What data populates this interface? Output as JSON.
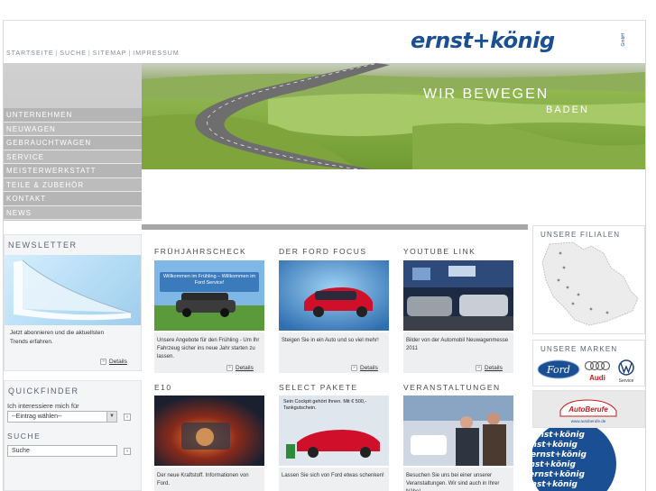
{
  "header": {
    "top_links": [
      "STARTSEITE",
      "SUCHE",
      "SITEMAP",
      "IMPRESSUM"
    ],
    "logo_text": "ernst+könig",
    "logo_suffix": "GmbH"
  },
  "nav": {
    "items": [
      "UNTERNEHMEN",
      "NEUWAGEN",
      "GEBRAUCHTWAGEN",
      "SERVICE",
      "MEISTERWERKSTATT",
      "TEILE & ZUBEHÖR",
      "KONTAKT",
      "NEWS"
    ]
  },
  "hero": {
    "title": "WIR BEWEGEN",
    "subtitle": "BADEN"
  },
  "newsletter": {
    "title": "NEWSLETTER",
    "text": "Jetzt abonnieren und die aktuellsten Trends erfahren.",
    "details_label": "Details"
  },
  "quickfinder": {
    "title": "QUICKFINDER",
    "interest_label": "Ich interessiere mich für",
    "select_value": "--Eintrag wählen--",
    "search_title": "SUCHE",
    "search_value": "Suche"
  },
  "tiles": [
    {
      "title": "FRÜHJAHRSCHECK",
      "image_caption": "Willkommen im Frühling – Willkommen im Ford Service!",
      "text": "Unsere Angebote für den Frühling - Um Ihr Fahrzeug sicher ins neue Jahr starten zu lassen.",
      "details_label": "Details"
    },
    {
      "title": "DER FORD FOCUS",
      "text": "Steigen Sie in ein Auto und so viel mehr!",
      "details_label": "Details"
    },
    {
      "title": "YOUTUBE LINK",
      "text": "Bilder von der Automobil Neuwagenmesse 2011",
      "details_label": "Details"
    },
    {
      "title": "E10",
      "text": "Der neue Kraftstoff. Informationen von Ford."
    },
    {
      "title": "SELECT PAKETE",
      "image_caption": "Sein Cockpit gehört Ihnen. Mit € 500,- Tankgutschein.",
      "text": "Lassen Sie sich von Ford etwas schenken!"
    },
    {
      "title": "VERANSTALTUNGEN",
      "text": "Besuchen Sie uns bei einer unserer Veranstaltungen. Wir sind auch in Ihrer Nähe!"
    }
  ],
  "right": {
    "filialen_title": "UNSERE FILIALEN",
    "marken_title": "UNSERE MARKEN",
    "brands": [
      "Ford",
      "Audi",
      "Service"
    ],
    "autoberufe_title": "AutoBerufe",
    "autoberufe_sub": "www.autoberufe.de",
    "pattern_text": "ernst+könig"
  },
  "colors": {
    "brand_blue": "#1b4f93",
    "nav_grey": "#bcbcbc",
    "divider": "#a7a7a7"
  }
}
